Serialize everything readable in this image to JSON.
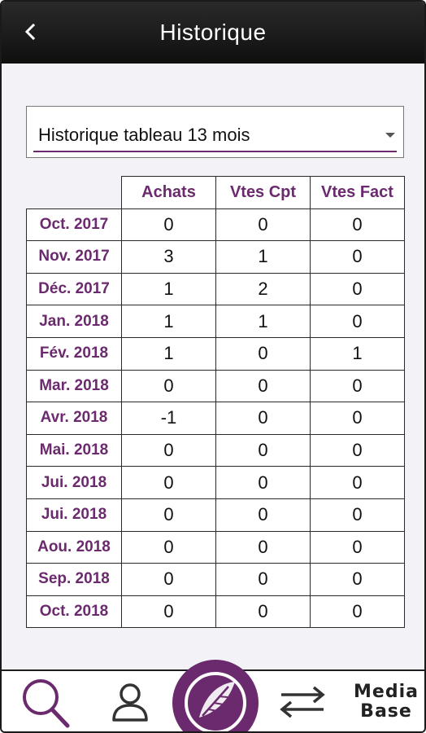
{
  "header": {
    "title": "Historique",
    "back_icon": "chevron-left-icon"
  },
  "selector": {
    "selected": "Historique tableau 13 mois"
  },
  "table": {
    "columns": [
      "Achats",
      "Vtes Cpt",
      "Vtes Fact"
    ],
    "rows": [
      {
        "month": "Oct. 2017",
        "values": [
          "0",
          "0",
          "0"
        ]
      },
      {
        "month": "Nov. 2017",
        "values": [
          "3",
          "1",
          "0"
        ]
      },
      {
        "month": "Déc. 2017",
        "values": [
          "1",
          "2",
          "0"
        ]
      },
      {
        "month": "Jan. 2018",
        "values": [
          "1",
          "1",
          "0"
        ]
      },
      {
        "month": "Fév. 2018",
        "values": [
          "1",
          "0",
          "1"
        ]
      },
      {
        "month": "Mar. 2018",
        "values": [
          "0",
          "0",
          "0"
        ]
      },
      {
        "month": "Avr. 2018",
        "values": [
          "-1",
          "0",
          "0"
        ]
      },
      {
        "month": "Mai. 2018",
        "values": [
          "0",
          "0",
          "0"
        ]
      },
      {
        "month": "Jui. 2018",
        "values": [
          "0",
          "0",
          "0"
        ]
      },
      {
        "month": "Jui. 2018",
        "values": [
          "0",
          "0",
          "0"
        ]
      },
      {
        "month": "Aou. 2018",
        "values": [
          "0",
          "0",
          "0"
        ]
      },
      {
        "month": "Sep. 2018",
        "values": [
          "0",
          "0",
          "0"
        ]
      },
      {
        "month": "Oct. 2018",
        "values": [
          "0",
          "0",
          "0"
        ]
      }
    ]
  },
  "footer": {
    "items": [
      {
        "icon": "search-icon"
      },
      {
        "icon": "user-icon"
      },
      {
        "icon": "logo-icon"
      },
      {
        "icon": "swap-icon"
      },
      {
        "label_line1": "Media",
        "label_line2": "Base"
      }
    ]
  },
  "colors": {
    "accent": "#6b2a6d",
    "header": "#1a1a1a"
  }
}
